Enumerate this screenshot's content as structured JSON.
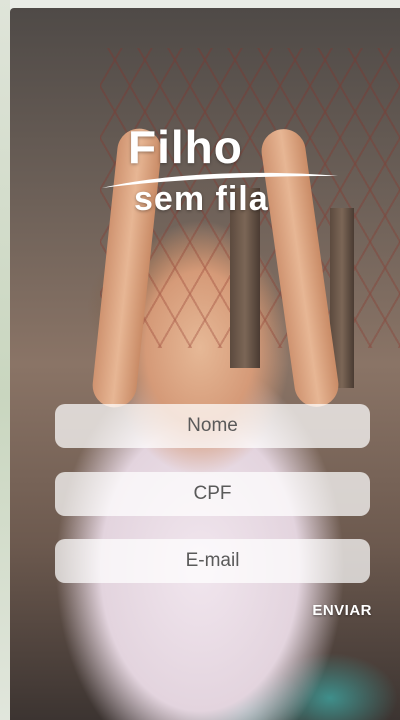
{
  "brand": {
    "line1": "Filho",
    "line2": "sem fila"
  },
  "form": {
    "nome_placeholder": "Nome",
    "cpf_placeholder": "CPF",
    "email_placeholder": "E-mail",
    "submit_label": "ENVIAR"
  }
}
